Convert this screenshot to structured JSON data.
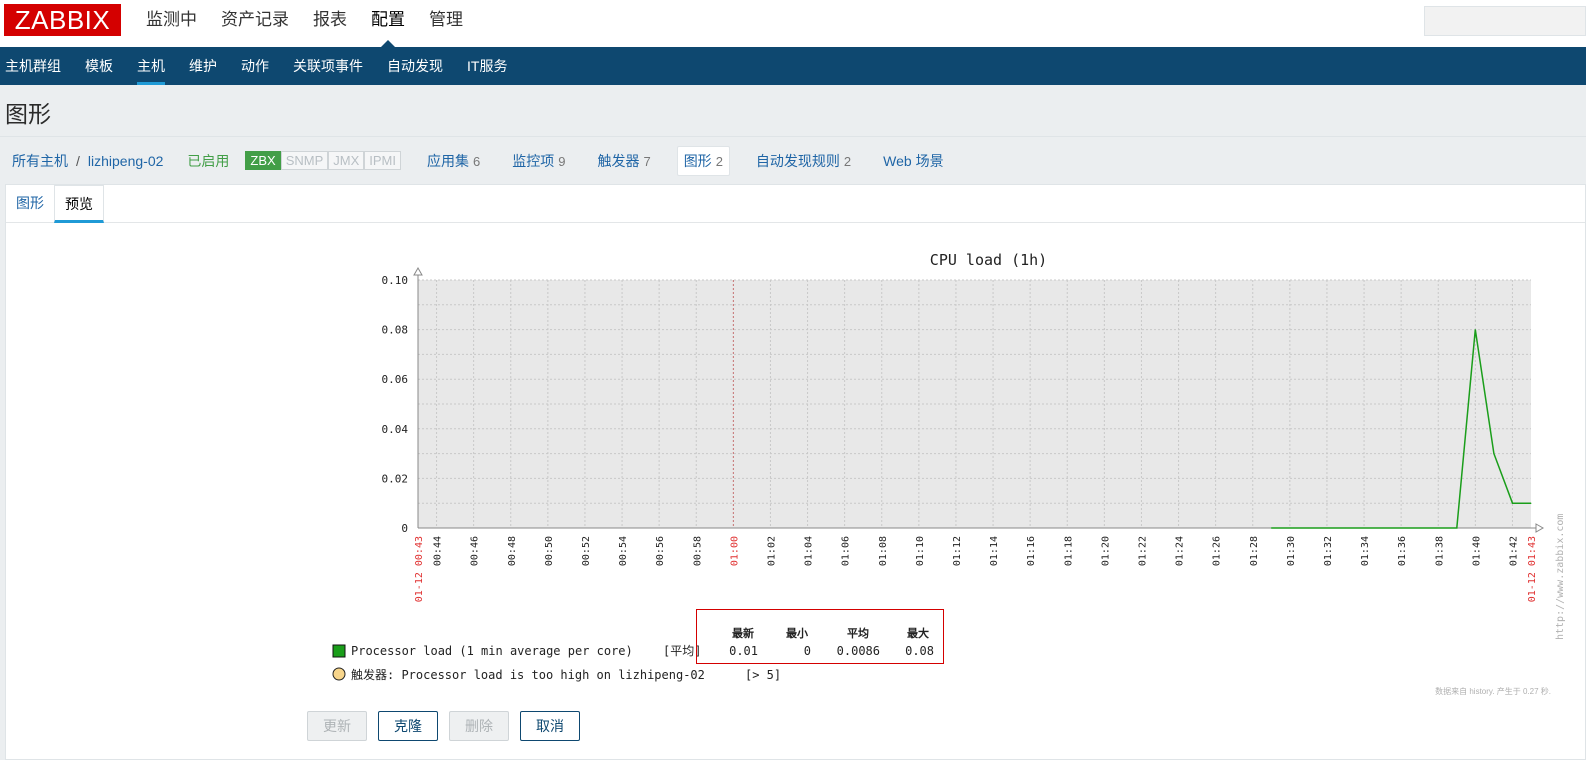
{
  "logo": "ZABBIX",
  "topnav": [
    "监测中",
    "资产记录",
    "报表",
    "配置",
    "管理"
  ],
  "subnav": [
    "主机群组",
    "模板",
    "主机",
    "维护",
    "动作",
    "关联项事件",
    "自动发现",
    "IT服务"
  ],
  "page_title": "图形",
  "hostbar": {
    "all_hosts": "所有主机",
    "sep": "/",
    "host": "lizhipeng-02",
    "status": "已启用",
    "availability": [
      "ZBX",
      "SNMP",
      "JMX",
      "IPMI"
    ],
    "tabs": [
      {
        "label": "应用集",
        "count": "6"
      },
      {
        "label": "监控项",
        "count": "9"
      },
      {
        "label": "触发器",
        "count": "7"
      },
      {
        "label": "图形",
        "count": "2"
      },
      {
        "label": "自动发现规则",
        "count": "2"
      },
      {
        "label": "Web 场景",
        "count": ""
      }
    ]
  },
  "form_tabs": [
    "图形",
    "预览"
  ],
  "chart_data": {
    "type": "line",
    "title": "CPU load (1h)",
    "y_tick_labels": [
      "0",
      "0.02",
      "0.04",
      "0.06",
      "0.08",
      "0.10"
    ],
    "ylim": [
      0,
      0.1
    ],
    "x_tick_labels": [
      "00:44",
      "00:46",
      "00:48",
      "00:50",
      "00:52",
      "00:54",
      "00:56",
      "00:58",
      "01:00",
      "01:02",
      "01:04",
      "01:06",
      "01:08",
      "01:10",
      "01:12",
      "01:14",
      "01:16",
      "01:18",
      "01:20",
      "01:22",
      "01:24",
      "01:26",
      "01:28",
      "01:30",
      "01:32",
      "01:34",
      "01:36",
      "01:38",
      "01:40",
      "01:42"
    ],
    "x_start_label": "01-12 00:43",
    "x_end_label": "01-12 01:43",
    "series": [
      {
        "name": "Processor load (1 min average per core)",
        "color": "#1a9e1a",
        "x": [
          "01:29",
          "01:31",
          "01:33",
          "01:35",
          "01:37",
          "01:39",
          "01:40",
          "01:41",
          "01:42",
          "01:43"
        ],
        "values": [
          0,
          0,
          0,
          0,
          0,
          0,
          0.08,
          0.03,
          0.01,
          0.01
        ]
      }
    ],
    "legend_headers": [
      "最新",
      "最小",
      "平均",
      "最大"
    ],
    "legend_func": "[平均]",
    "legend_values": [
      "0.01",
      "0",
      "0.0086",
      "0.08"
    ],
    "trigger_label": "触发器: Processor load is too high on lizhipeng-02",
    "trigger_value": "[> 5]",
    "watermark": "http://www.zabbix.com",
    "footer_note": "数据来自 history. 产生于 0.27 秒."
  },
  "buttons": {
    "update": "更新",
    "clone": "克隆",
    "delete": "删除",
    "cancel": "取消"
  }
}
